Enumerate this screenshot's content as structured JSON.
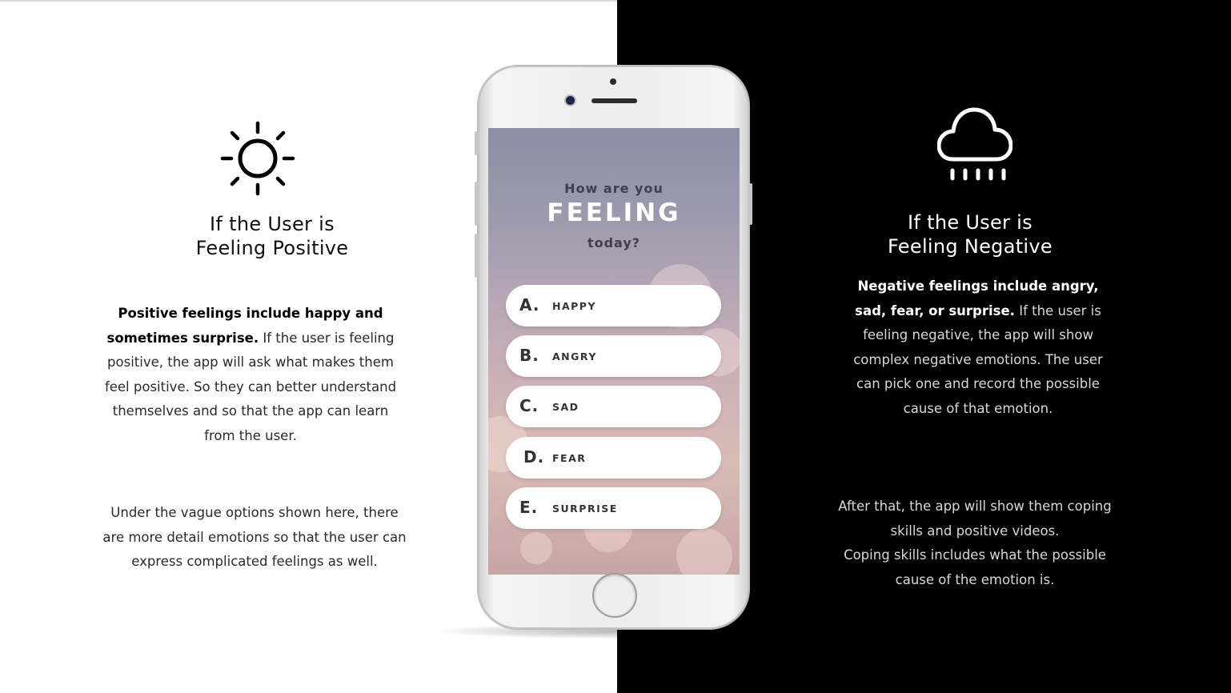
{
  "left": {
    "icon": "sun-icon",
    "heading_line1": "If the User is",
    "heading_line2": "Feeling Positive",
    "para1_bold": "Positive feelings include happy and sometimes surprise.",
    "para1_rest": "If the user is feeling positive, the app will ask what makes them feel positive. So they can better understand themselves and so that the app can learn from the user.",
    "para2": "Under the vague options shown here, there are more detail emotions so that the user can express complicated feelings as well."
  },
  "right": {
    "icon": "rain-cloud-icon",
    "heading_line1": "If the User is",
    "heading_line2": "Feeling Negative",
    "para1_bold": "Negative feelings include angry, sad, fear, or surprise.",
    "para1_rest": "If the user is feeling negative, the app will show complex negative emotions. The user can pick one and record the possible cause of that emotion.",
    "para2_line1": "After that, the app will show them coping skills and positive videos.",
    "para2_line2": "Coping skills includes what the possible cause of the emotion is."
  },
  "phone": {
    "question_line1": "How are you",
    "question_line2": "FEELING",
    "question_line3": "today?",
    "options": [
      {
        "letter": "A.",
        "label": "HAPPY"
      },
      {
        "letter": "B.",
        "label": "ANGRY"
      },
      {
        "letter": "C.",
        "label": "SAD"
      },
      {
        "letter": "D.",
        "label": "FEAR"
      },
      {
        "letter": "E.",
        "label": "SURPRISE"
      }
    ]
  },
  "colors": {
    "left_background": "#ffffff",
    "right_background": "#000000"
  }
}
